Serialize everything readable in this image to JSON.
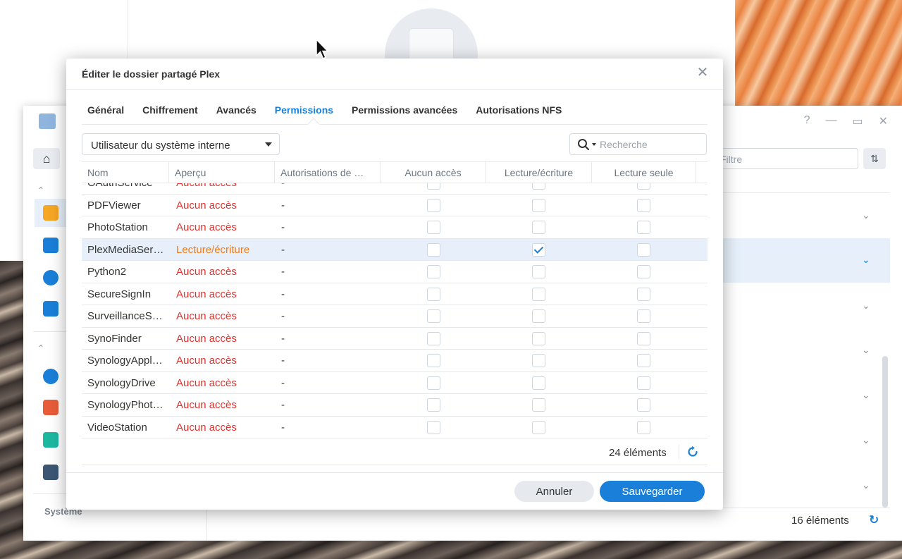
{
  "background": {
    "filter_placeholder": "Filtre",
    "section_system": "Système",
    "item_count": "16 éléments"
  },
  "dialog": {
    "title": "Éditer le dossier partagé Plex",
    "tabs": [
      {
        "label": "Général",
        "active": false
      },
      {
        "label": "Chiffrement",
        "active": false
      },
      {
        "label": "Avancés",
        "active": false
      },
      {
        "label": "Permissions",
        "active": true
      },
      {
        "label": "Permissions avancées",
        "active": false
      },
      {
        "label": "Autorisations NFS",
        "active": false
      }
    ],
    "user_type_select": "Utilisateur du système interne",
    "search_placeholder": "Recherche",
    "columns": [
      "Nom",
      "Aperçu",
      "Autorisations de …",
      "Aucun accès",
      "Lecture/écriture",
      "Lecture seule"
    ],
    "rows": [
      {
        "name": "OAuthService",
        "preview": "Aucun accès",
        "auth": "-",
        "no_access": false,
        "read_write": false,
        "read_only": false,
        "selected": false
      },
      {
        "name": "PDFViewer",
        "preview": "Aucun accès",
        "auth": "-",
        "no_access": false,
        "read_write": false,
        "read_only": false,
        "selected": false
      },
      {
        "name": "PhotoStation",
        "preview": "Aucun accès",
        "auth": "-",
        "no_access": false,
        "read_write": false,
        "read_only": false,
        "selected": false
      },
      {
        "name": "PlexMediaSer…",
        "preview": "Lecture/écriture",
        "auth": "-",
        "no_access": false,
        "read_write": true,
        "read_only": false,
        "selected": true
      },
      {
        "name": "Python2",
        "preview": "Aucun accès",
        "auth": "-",
        "no_access": false,
        "read_write": false,
        "read_only": false,
        "selected": false
      },
      {
        "name": "SecureSignIn",
        "preview": "Aucun accès",
        "auth": "-",
        "no_access": false,
        "read_write": false,
        "read_only": false,
        "selected": false
      },
      {
        "name": "SurveillanceS…",
        "preview": "Aucun accès",
        "auth": "-",
        "no_access": false,
        "read_write": false,
        "read_only": false,
        "selected": false
      },
      {
        "name": "SynoFinder",
        "preview": "Aucun accès",
        "auth": "-",
        "no_access": false,
        "read_write": false,
        "read_only": false,
        "selected": false
      },
      {
        "name": "SynologyAppl…",
        "preview": "Aucun accès",
        "auth": "-",
        "no_access": false,
        "read_write": false,
        "read_only": false,
        "selected": false
      },
      {
        "name": "SynologyDrive",
        "preview": "Aucun accès",
        "auth": "-",
        "no_access": false,
        "read_write": false,
        "read_only": false,
        "selected": false
      },
      {
        "name": "SynologyPhot…",
        "preview": "Aucun accès",
        "auth": "-",
        "no_access": false,
        "read_write": false,
        "read_only": false,
        "selected": false
      },
      {
        "name": "VideoStation",
        "preview": "Aucun accès",
        "auth": "-",
        "no_access": false,
        "read_write": false,
        "read_only": false,
        "selected": false
      }
    ],
    "item_count": "24 éléments",
    "cancel_label": "Annuler",
    "save_label": "Sauvegarder"
  },
  "colors": {
    "accent": "#1a7fd8",
    "no_access": "#e0332f",
    "read_write": "#ef7a1a",
    "selected_row": "#e7f0fa"
  }
}
